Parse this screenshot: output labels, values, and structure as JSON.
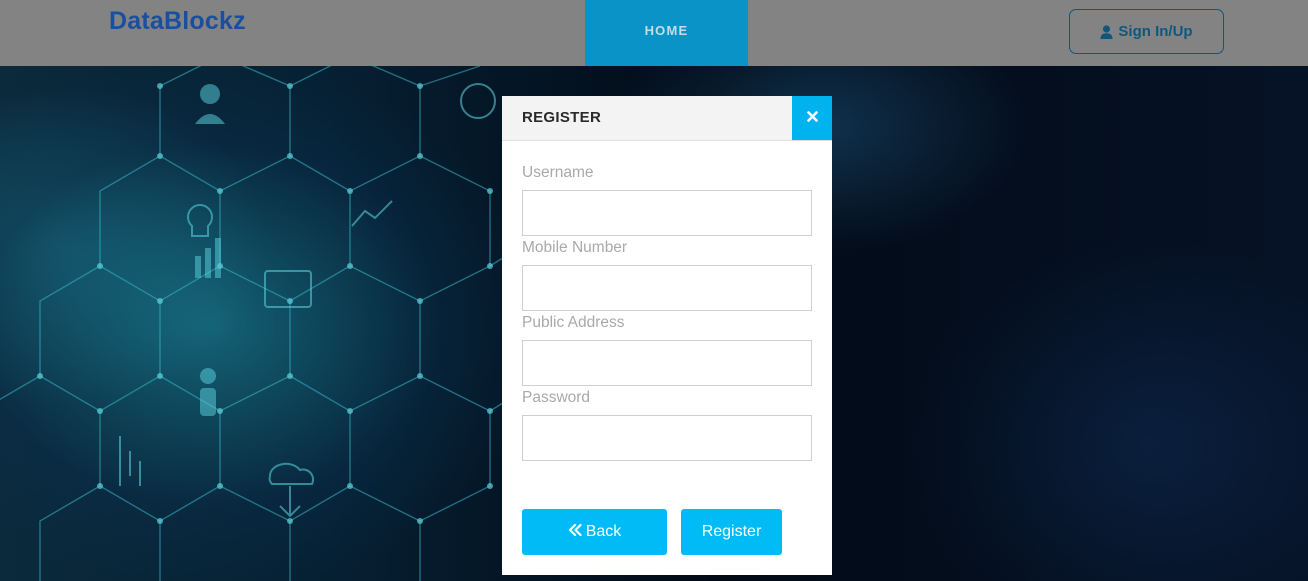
{
  "navbar": {
    "brand": "DataBlockz",
    "home_label": "HOME",
    "signin_label": "Sign In/Up",
    "signin_icon": "user-icon"
  },
  "modal": {
    "title": "REGISTER",
    "close_icon": "close-icon",
    "fields": {
      "username": {
        "label": "Username",
        "value": ""
      },
      "mobile": {
        "label": "Mobile Number",
        "value": ""
      },
      "address": {
        "label": "Public Address",
        "value": ""
      },
      "password": {
        "label": "Password",
        "value": ""
      }
    },
    "back_label": "Back",
    "back_icon": "double-chevron-left-icon",
    "register_label": "Register"
  },
  "colors": {
    "accent": "#00bbf6",
    "nav_active": "#0a93c6",
    "brand": "#1a4fa0",
    "navbar_bg": "#838383"
  }
}
